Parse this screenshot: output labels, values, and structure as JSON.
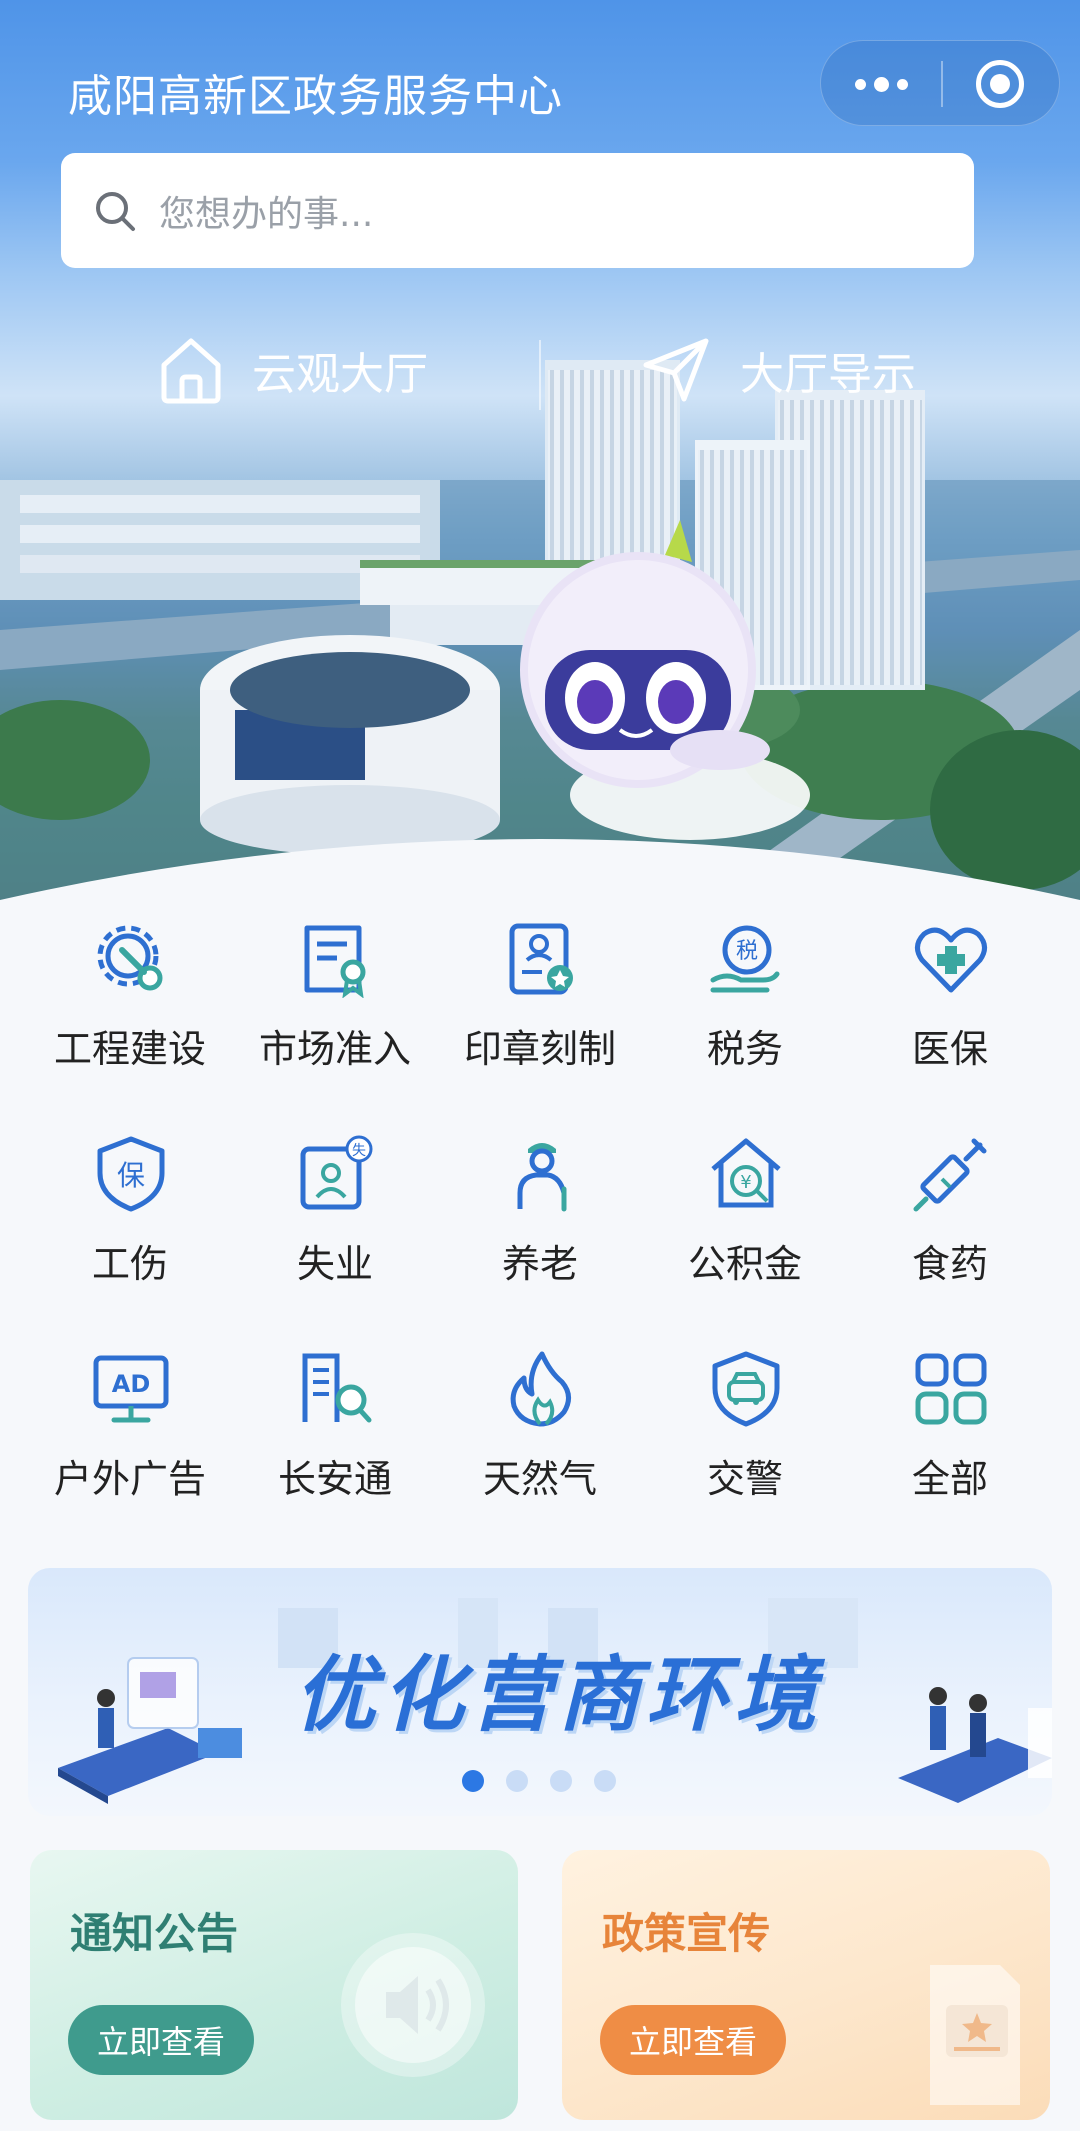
{
  "header": {
    "title": "咸阳高新区政务服务中心"
  },
  "search": {
    "placeholder": "您想办的事..."
  },
  "hall_links": [
    {
      "label": "云观大厅",
      "icon": "home-icon"
    },
    {
      "label": "大厅导示",
      "icon": "send-icon"
    }
  ],
  "services": [
    {
      "label": "工程建设",
      "icon": "gear-wrench-icon"
    },
    {
      "label": "市场准入",
      "icon": "license-certificate-icon"
    },
    {
      "label": "印章刻制",
      "icon": "seal-card-icon"
    },
    {
      "label": "税务",
      "icon": "tax-hand-icon"
    },
    {
      "label": "医保",
      "icon": "medical-heart-icon"
    },
    {
      "label": "工伤",
      "icon": "injury-shield-icon"
    },
    {
      "label": "失业",
      "icon": "unemployment-card-icon"
    },
    {
      "label": "养老",
      "icon": "elderly-person-icon"
    },
    {
      "label": "公积金",
      "icon": "housing-fund-icon"
    },
    {
      "label": "食药",
      "icon": "syringe-icon"
    },
    {
      "label": "户外广告",
      "icon": "ad-monitor-icon"
    },
    {
      "label": "长安通",
      "icon": "building-search-icon"
    },
    {
      "label": "天然气",
      "icon": "flame-icon"
    },
    {
      "label": "交警",
      "icon": "traffic-police-icon"
    },
    {
      "label": "全部",
      "icon": "all-apps-icon"
    }
  ],
  "banner": {
    "title": "优化营商环境",
    "slide_count": 4,
    "active_slide": 1
  },
  "cards": [
    {
      "title": "通知公告",
      "button": "立即查看",
      "icon": "speaker-icon"
    },
    {
      "title": "政策宣传",
      "button": "立即查看",
      "icon": "document-star-icon"
    }
  ],
  "colors": {
    "brand_blue": "#2c78e4",
    "icon_blue": "#2e6fd1",
    "icon_teal": "#3aa6a0",
    "notice_green": "#3f9b8d",
    "policy_orange": "#ef8d45"
  }
}
